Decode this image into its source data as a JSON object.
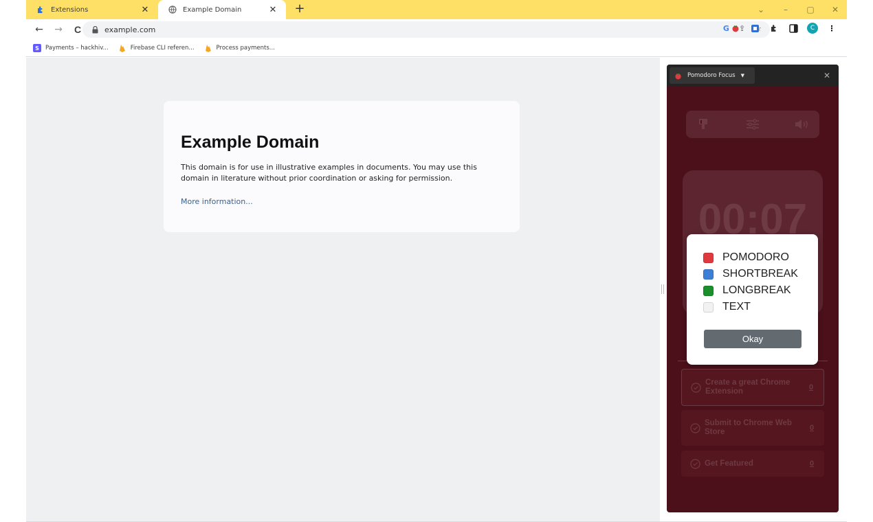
{
  "browser": {
    "tabs": [
      {
        "title": "Extensions",
        "icon": "puzzle-icon",
        "active": false
      },
      {
        "title": "Example Domain",
        "icon": "globe-icon",
        "active": true
      }
    ],
    "new_tab_label": "+",
    "window_controls": {
      "dropdown": "⌄",
      "minimize": "–",
      "restore": "▢",
      "close": "✕"
    },
    "address": "example.com",
    "bookmarks": [
      {
        "label": "Payments – hackhiv...",
        "icon": "stripe-icon",
        "color": "#635bff"
      },
      {
        "label": "Firebase CLI referen...",
        "icon": "firebase-icon",
        "color": "#f5a623"
      },
      {
        "label": "Process payments...",
        "icon": "firebase-icon",
        "color": "#f5a623"
      }
    ],
    "profile_initial": "C",
    "accent_color": "#fde065"
  },
  "page": {
    "heading": "Example Domain",
    "body": "This domain is for use in illustrative examples in documents. You may use this domain in literature without prior coordination or asking for permission.",
    "link": "More information..."
  },
  "side_panel": {
    "selector_label": "Pomodoro Focus",
    "close_label": "✕",
    "timer": "00:07",
    "background_color": "#4c101a",
    "tasks": [
      {
        "label": "Create a great Chrome Extension",
        "count": "0"
      },
      {
        "label": "Submit to Chrome Web Store",
        "count": "0"
      },
      {
        "label": "Get Featured",
        "count": "0"
      }
    ]
  },
  "dialog": {
    "legend": [
      {
        "label": "POMODORO",
        "color": "#e0393e"
      },
      {
        "label": "SHORTBREAK",
        "color": "#3d7fd6"
      },
      {
        "label": "LONGBREAK",
        "color": "#1a8f2a"
      },
      {
        "label": "TEXT",
        "color": "#f2f2f2"
      }
    ],
    "okay_label": "Okay"
  }
}
